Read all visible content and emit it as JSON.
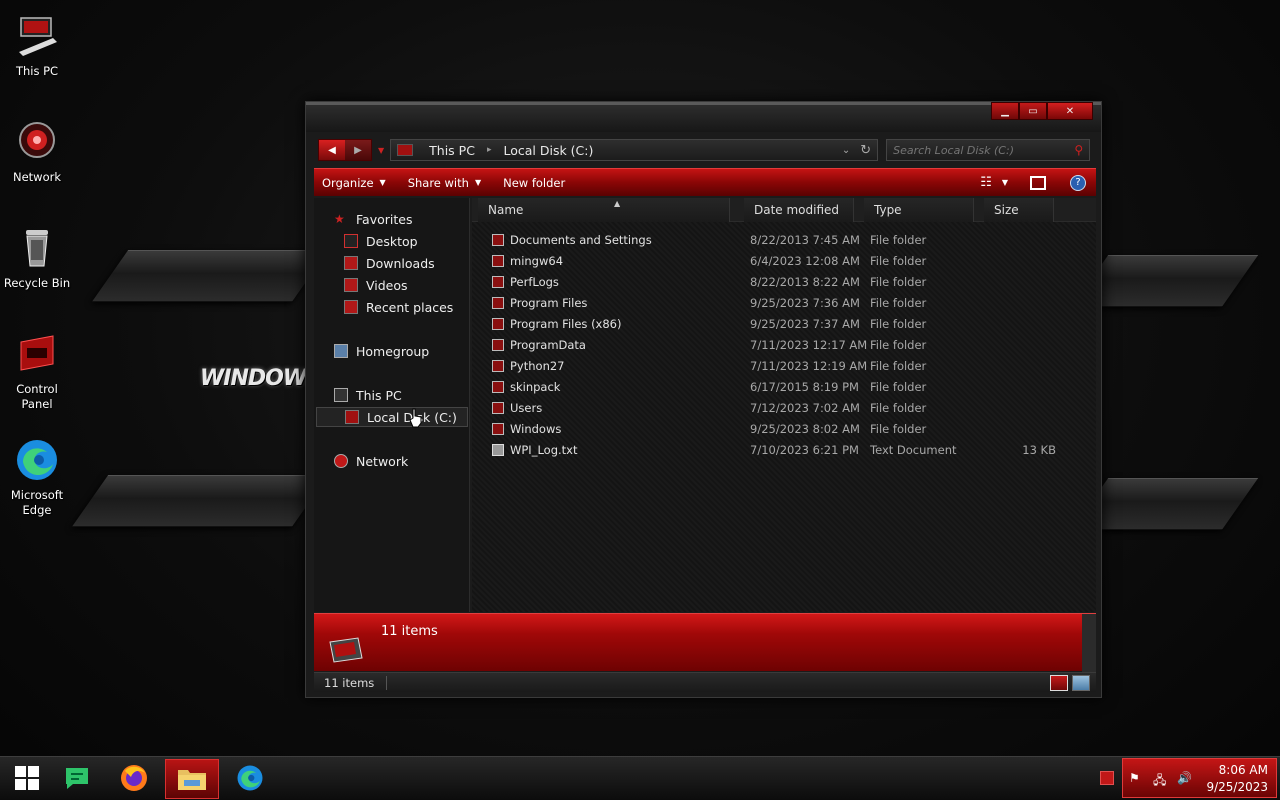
{
  "desktop": {
    "icons": [
      {
        "label": "This PC",
        "icon": "this-pc-icon"
      },
      {
        "label": "Network",
        "icon": "network-icon"
      },
      {
        "label": "Recycle Bin",
        "icon": "recycle-bin-icon"
      },
      {
        "label": "Control Panel",
        "icon": "control-panel-icon"
      },
      {
        "label": "Microsoft Edge",
        "icon": "edge-icon"
      }
    ],
    "wallpaper_text": "WINDOWS"
  },
  "window": {
    "nav": {
      "back": "◀",
      "forward": "▶"
    },
    "address": {
      "crumbs": [
        "This PC",
        "Local Disk (C:)"
      ]
    },
    "search": {
      "placeholder": "Search Local Disk (C:)"
    },
    "toolbar": {
      "organize": "Organize",
      "share_with": "Share with",
      "new_folder": "New folder"
    },
    "nav_pane": {
      "favorites": "Favorites",
      "desktop": "Desktop",
      "downloads": "Downloads",
      "videos": "Videos",
      "recent_places": "Recent places",
      "homegroup": "Homegroup",
      "this_pc": "This PC",
      "local_disk": "Local Disk (C:)",
      "network": "Network"
    },
    "columns": {
      "name": "Name",
      "date_modified": "Date modified",
      "type": "Type",
      "size": "Size"
    },
    "files": [
      {
        "name": "Documents and Settings",
        "date": "8/22/2013 7:45 AM",
        "type": "File folder",
        "size": ""
      },
      {
        "name": "mingw64",
        "date": "6/4/2023 12:08 AM",
        "type": "File folder",
        "size": ""
      },
      {
        "name": "PerfLogs",
        "date": "8/22/2013 8:22 AM",
        "type": "File folder",
        "size": ""
      },
      {
        "name": "Program Files",
        "date": "9/25/2023 7:36 AM",
        "type": "File folder",
        "size": ""
      },
      {
        "name": "Program Files (x86)",
        "date": "9/25/2023 7:37 AM",
        "type": "File folder",
        "size": ""
      },
      {
        "name": "ProgramData",
        "date": "7/11/2023 12:17 AM",
        "type": "File folder",
        "size": ""
      },
      {
        "name": "Python27",
        "date": "7/11/2023 12:19 AM",
        "type": "File folder",
        "size": ""
      },
      {
        "name": "skinpack",
        "date": "6/17/2015 8:19 PM",
        "type": "File folder",
        "size": ""
      },
      {
        "name": "Users",
        "date": "7/12/2023 7:02 AM",
        "type": "File folder",
        "size": ""
      },
      {
        "name": "Windows",
        "date": "9/25/2023 8:02 AM",
        "type": "File folder",
        "size": ""
      },
      {
        "name": "WPI_Log.txt",
        "date": "7/10/2023 6:21 PM",
        "type": "Text Document",
        "size": "13 KB"
      }
    ],
    "details_pane": {
      "count": "11 items"
    },
    "statusbar": {
      "count": "11 items"
    }
  },
  "taskbar": {
    "apps": [
      "start-icon",
      "chat-icon",
      "firefox-icon",
      "file-explorer-icon",
      "edge-icon"
    ],
    "clock": {
      "time": "8:06 AM",
      "date": "9/25/2023"
    }
  },
  "colors": {
    "accent": "#c41616",
    "accent_dark": "#6a0404",
    "bg": "#0d0d0d"
  }
}
